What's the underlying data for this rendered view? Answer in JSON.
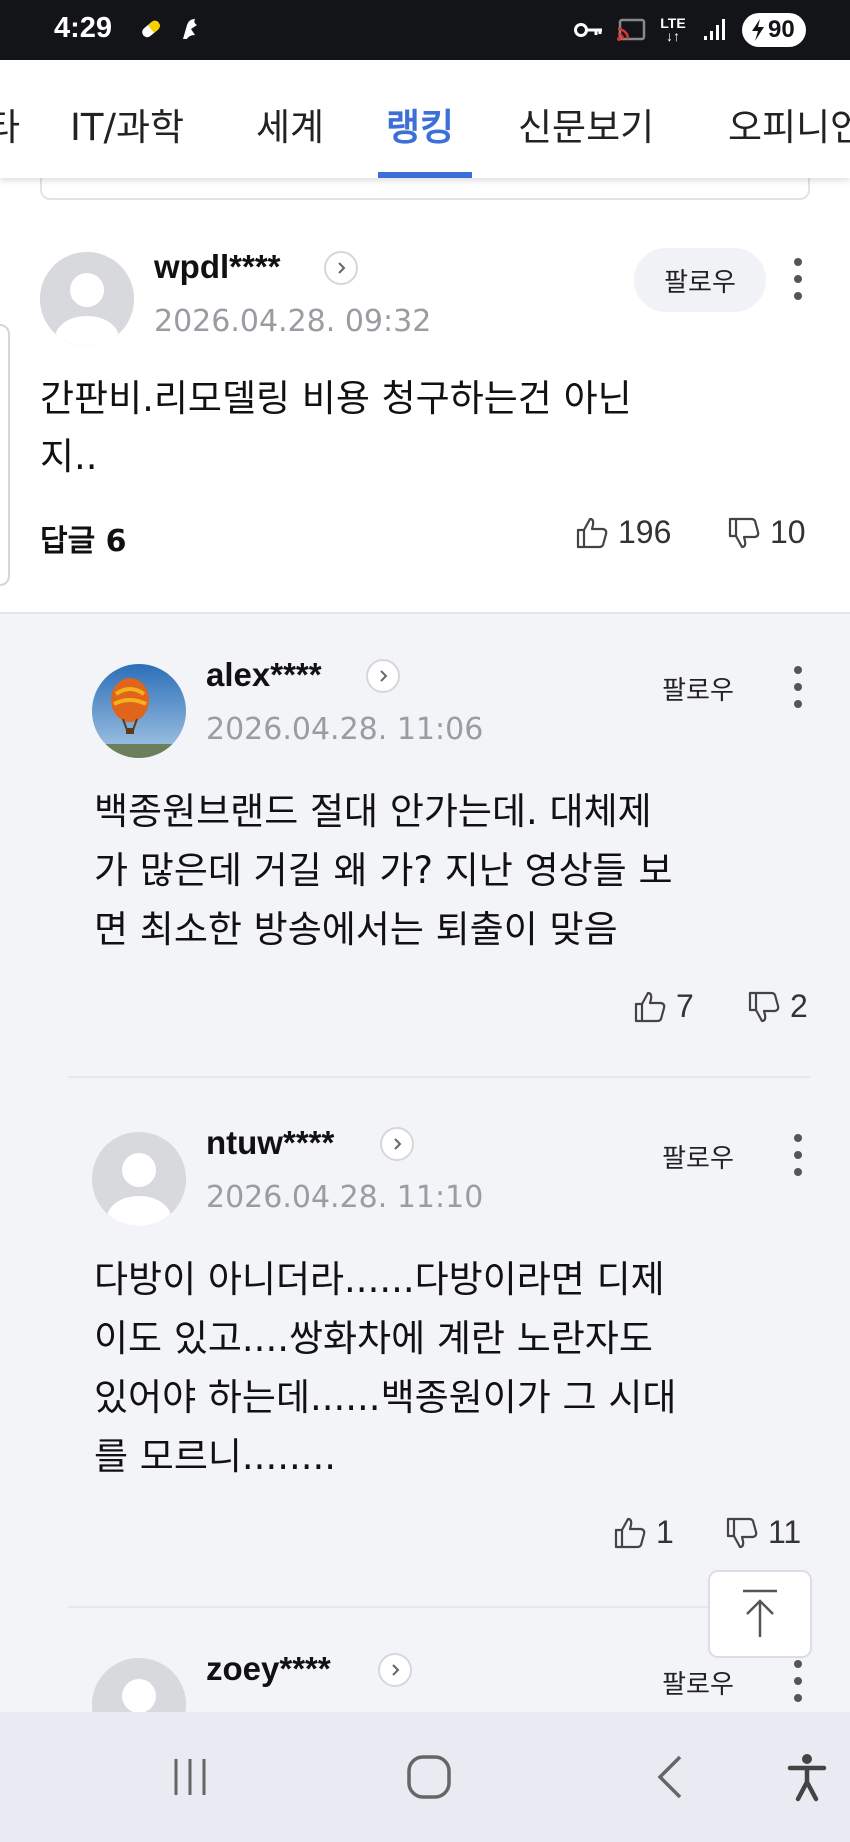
{
  "status_bar": {
    "time": "4:29",
    "lte_top": "LTE",
    "lte_bottom": "↓↑",
    "battery": "90",
    "icons": [
      "notification-icon",
      "bird-icon",
      "key-icon",
      "cast-icon",
      "lte-icon",
      "signal-icon",
      "battery-icon"
    ]
  },
  "tabs": [
    {
      "label": "타",
      "active": false
    },
    {
      "label": "IT/과학",
      "active": false
    },
    {
      "label": "세계",
      "active": false
    },
    {
      "label": "랭킹",
      "active": true
    },
    {
      "label": "신문보기",
      "active": false
    },
    {
      "label": "오피니언",
      "active": false
    }
  ],
  "comment": {
    "username": "wpdl****",
    "date": "2026.04.28. 09:32",
    "follow_label": "팔로우",
    "text_line1": "간판비.리모델링 비용 청구하는건 아닌",
    "text_line2": "지..",
    "reply_label": "답글 6",
    "likes": "196",
    "dislikes": "10"
  },
  "replies": [
    {
      "username": "alex****",
      "date": "2026.04.28. 11:06",
      "follow_label": "팔로우",
      "lines": [
        "백종원브랜드 절대 안가는데. 대체제",
        "가 많은데 거길 왜 가? 지난 영상들 보",
        "면 최소한 방송에서는 퇴출이 맞음"
      ],
      "likes": "7",
      "dislikes": "2"
    },
    {
      "username": "ntuw****",
      "date": "2026.04.28. 11:10",
      "follow_label": "팔로우",
      "lines": [
        "다방이 아니더라......다방이라면 디제",
        "이도 있고....쌍화차에 계란 노란자도",
        "있어야 하는데......백종원이가 그 시대",
        "를 모르니........"
      ],
      "likes": "1",
      "dislikes": "11"
    },
    {
      "username": "zoey****",
      "follow_label": "팔로우"
    }
  ],
  "colors": {
    "accent": "#3d6fd8",
    "status_bar": "#121418",
    "reply_background": "#f3f4f8",
    "nav_background": "#e9ebf2"
  }
}
